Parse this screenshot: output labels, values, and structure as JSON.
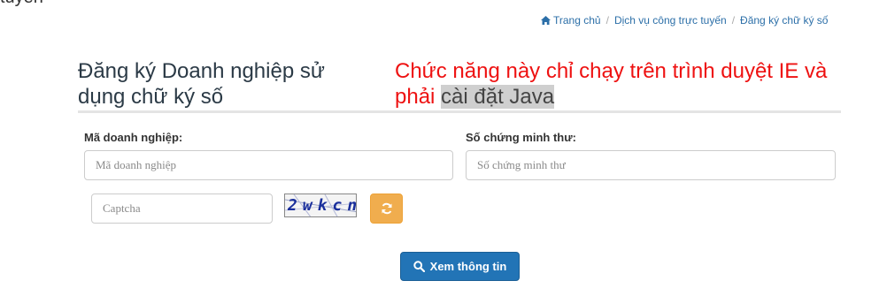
{
  "top_clipped_text": "tuyến",
  "breadcrumb": {
    "home": "Trang chủ",
    "services": "Dịch vụ công trực tuyến",
    "current": "Đăng ký chữ ký số"
  },
  "page": {
    "title": "Đăng ký Doanh nghiệp sử dụng chữ ký số",
    "warning_prefix": "Chức năng này chỉ chạy trên trình duyệt IE và phải ",
    "warning_highlight": "cài đặt Java"
  },
  "form": {
    "business_code": {
      "label": "Mã doanh nghiệp:",
      "placeholder": "Mã doanh nghiệp",
      "value": ""
    },
    "id_number": {
      "label": "Số chứng minh thư:",
      "placeholder": "Số chứng minh thư",
      "value": ""
    },
    "captcha": {
      "placeholder": "Captcha",
      "value": "",
      "image_text": "2wkcn"
    }
  },
  "buttons": {
    "refresh_icon": "refresh-icon",
    "view_label": "Xem thông tin",
    "view_icon": "search-icon"
  },
  "colors": {
    "warning": "#ee1111",
    "primary": "#2274b6",
    "refresh": "#f0ad4e",
    "link": "#2c6fa8"
  }
}
